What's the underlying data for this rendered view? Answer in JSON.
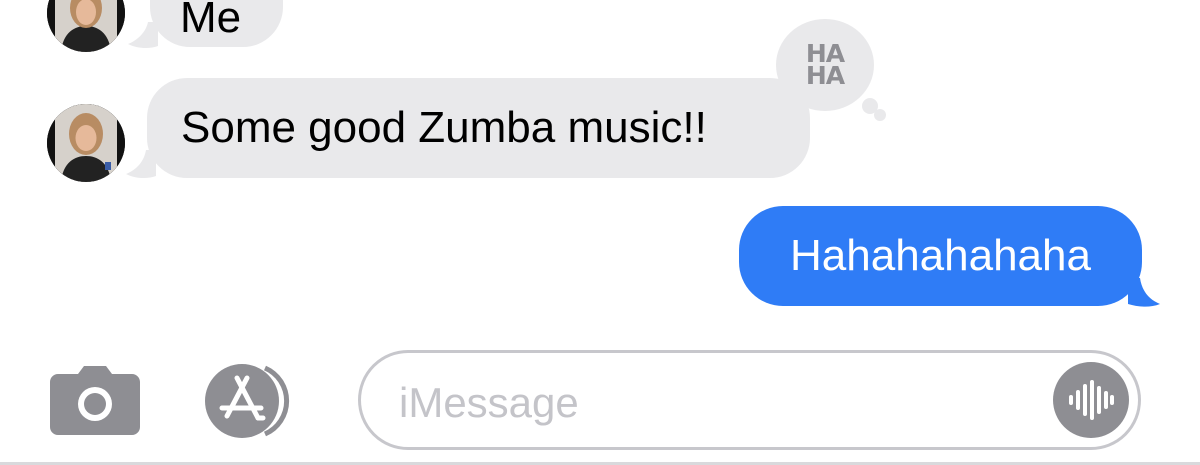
{
  "messages": {
    "top_partial": "Me",
    "received": "Some good Zumba music!!",
    "sent": "Hahahahahaha"
  },
  "tapback": {
    "line1": "HA",
    "line2": "HA"
  },
  "composer": {
    "placeholder": "iMessage"
  },
  "colors": {
    "received_bubble": "#e9e9eb",
    "sent_bubble": "#2f7cf6",
    "icon_gray": "#8e8e93"
  },
  "icons": {
    "camera": "camera-icon",
    "app_store": "app-store-icon",
    "audio": "audio-waveform-icon"
  }
}
